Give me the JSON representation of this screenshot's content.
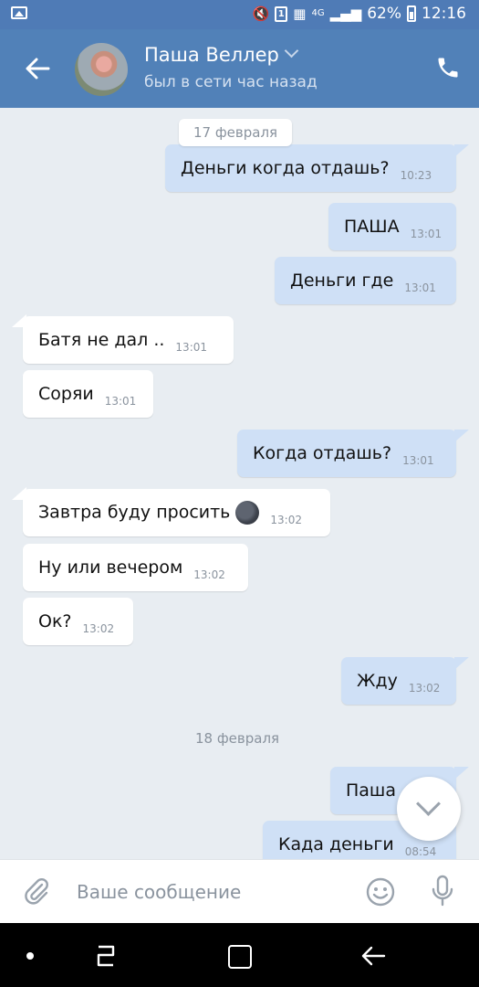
{
  "status_bar": {
    "battery_percent": "62%",
    "time": "12:16",
    "sim_slot": "1",
    "network": "4G"
  },
  "header": {
    "contact_name": "Паша Веллер",
    "contact_status": "был в сети час назад"
  },
  "dates": {
    "first": "17 февраля",
    "second": "18 февраля"
  },
  "messages": [
    {
      "direction": "out",
      "text": "Деньги когда отдашь?",
      "time": "10:23"
    },
    {
      "direction": "out",
      "text": "ПАША",
      "time": "13:01"
    },
    {
      "direction": "out",
      "text": "Деньги где",
      "time": "13:01"
    },
    {
      "direction": "in",
      "text": "Батя не дал ..",
      "time": "13:01"
    },
    {
      "direction": "in",
      "text": "Соряи",
      "time": "13:01"
    },
    {
      "direction": "out",
      "text": "Когда отдашь?",
      "time": "13:01"
    },
    {
      "direction": "in",
      "text": "Завтра буду просить",
      "time": "13:02",
      "emoji": "new-moon-face"
    },
    {
      "direction": "in",
      "text": "Ну или вечером",
      "time": "13:02"
    },
    {
      "direction": "in",
      "text": "Ок?",
      "time": "13:02"
    },
    {
      "direction": "out",
      "text": "Жду",
      "time": "13:02"
    },
    {
      "direction": "out",
      "text": "Паша",
      "time": ""
    },
    {
      "direction": "out",
      "text": "Када деньги",
      "time": "08:54"
    }
  ],
  "composer": {
    "placeholder": "Ваше сообщение"
  },
  "colors": {
    "header": "#5181b8",
    "outgoing_bubble": "#cfe0f6",
    "incoming_bubble": "#ffffff",
    "chat_background": "#e8edf2"
  }
}
